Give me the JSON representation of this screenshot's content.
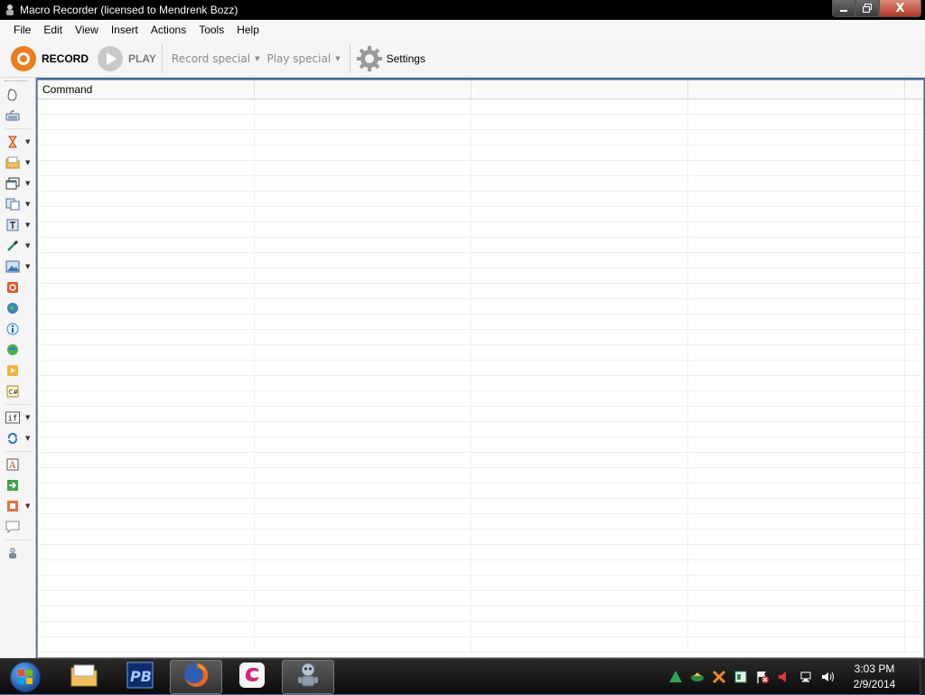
{
  "window": {
    "title": "Macro Recorder (licensed to Mendrenk Bozz)",
    "close_glyph": "X"
  },
  "menu": [
    "File",
    "Edit",
    "View",
    "Insert",
    "Actions",
    "Tools",
    "Help"
  ],
  "toolbar": {
    "record_label": "RECORD",
    "play_label": "PLAY",
    "record_special_label": "Record special",
    "play_special_label": "Play special",
    "settings_label": "Settings",
    "accent_color": "#ee7b1e"
  },
  "left_tools": [
    {
      "name": "mouse-click-tool",
      "icon": "mouse-icon",
      "dropdown": false
    },
    {
      "name": "keyboard-tool",
      "icon": "keyboard-icon",
      "dropdown": false
    },
    {
      "name": "wait-tool",
      "icon": "hourglass-icon",
      "dropdown": true
    },
    {
      "name": "file-tool",
      "icon": "folder-icon",
      "dropdown": true
    },
    {
      "name": "window-tool",
      "icon": "window-icon",
      "dropdown": true
    },
    {
      "name": "clipboard-tool",
      "icon": "clipboard-icon",
      "dropdown": true
    },
    {
      "name": "text-tool",
      "icon": "text-box-icon",
      "dropdown": true
    },
    {
      "name": "pixel-color-tool",
      "icon": "eyedropper-icon",
      "dropdown": true
    },
    {
      "name": "image-search-tool",
      "icon": "image-icon",
      "dropdown": true
    },
    {
      "name": "stop-tool",
      "icon": "stop-icon",
      "dropdown": false
    },
    {
      "name": "web-tool",
      "icon": "globe-icon",
      "dropdown": false
    },
    {
      "name": "info-tool",
      "icon": "info-icon",
      "dropdown": false
    },
    {
      "name": "internet-tool",
      "icon": "earth-icon",
      "dropdown": false
    },
    {
      "name": "run-macro-tool",
      "icon": "play-macro-icon",
      "dropdown": false
    },
    {
      "name": "csharp-tool",
      "icon": "csharp-icon",
      "dropdown": false
    },
    {
      "name": "if-tool",
      "icon": "if-icon",
      "dropdown": true
    },
    {
      "name": "loop-tool",
      "icon": "loop-icon",
      "dropdown": true
    },
    {
      "name": "label-tool",
      "icon": "label-icon",
      "dropdown": false
    },
    {
      "name": "goto-tool",
      "icon": "goto-arrow-icon",
      "dropdown": false
    },
    {
      "name": "message-tool",
      "icon": "message-box-icon",
      "dropdown": true
    },
    {
      "name": "comment-tool",
      "icon": "comment-icon",
      "dropdown": false
    },
    {
      "name": "robot-tool",
      "icon": "robot-icon",
      "dropdown": false
    }
  ],
  "grid": {
    "columns": [
      "Command",
      "",
      "",
      ""
    ]
  },
  "taskbar": {
    "apps": [
      {
        "name": "explorer-task",
        "icon": "folder-icon"
      },
      {
        "name": "powerbuilder-task",
        "icon": "pb-icon"
      },
      {
        "name": "firefox-task",
        "icon": "firefox-icon"
      },
      {
        "name": "eclipse-task",
        "icon": "swirl-icon"
      },
      {
        "name": "macro-recorder-task",
        "icon": "robot-icon"
      }
    ],
    "time": "3:03 PM",
    "date": "2/9/2014"
  }
}
